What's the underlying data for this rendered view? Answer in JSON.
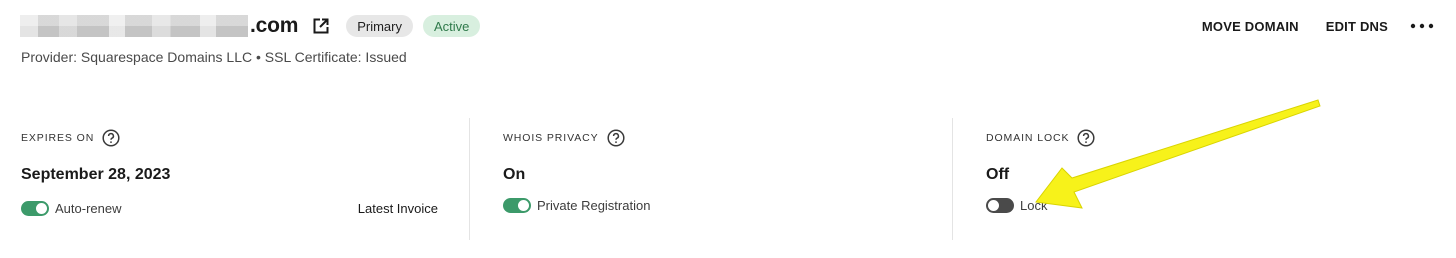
{
  "domain": {
    "tld": ".com",
    "badges": {
      "primary": "Primary",
      "active": "Active"
    },
    "subtitle": "Provider: Squarespace Domains LLC • SSL Certificate: Issued"
  },
  "actions": {
    "move_domain": "MOVE DOMAIN",
    "edit_dns": "EDIT DNS"
  },
  "cards": {
    "expires": {
      "label": "EXPIRES ON",
      "value": "September 28, 2023",
      "toggle_label": "Auto-renew",
      "toggle_on": true,
      "link": "Latest Invoice"
    },
    "whois": {
      "label": "WHOIS PRIVACY",
      "value": "On",
      "toggle_label": "Private Registration",
      "toggle_on": true
    },
    "lock": {
      "label": "DOMAIN LOCK",
      "value": "Off",
      "toggle_label": "Lock",
      "toggle_on": false
    }
  },
  "colors": {
    "toggle_on": "#3c9a6a",
    "toggle_off": "#4a4a4a",
    "active_badge_bg": "#d8efdf",
    "active_badge_text": "#2f7a4b",
    "annotation_arrow": "#f7f21a"
  },
  "icons": {
    "external_link": "external-link-icon",
    "help": "help-circle-icon",
    "more": "more-horizontal-icon"
  }
}
